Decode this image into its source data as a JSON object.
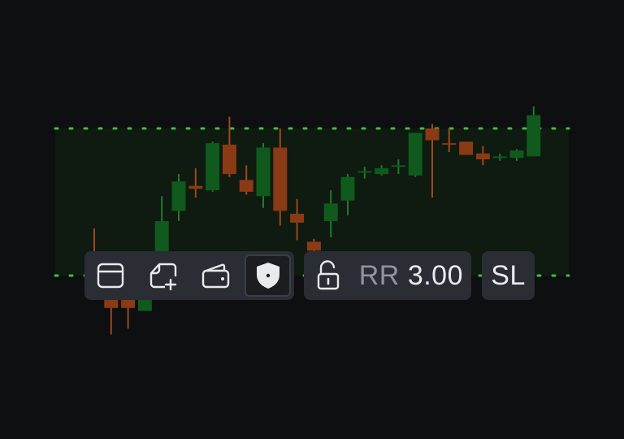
{
  "colors": {
    "background": "#0e0f11",
    "zone_fill": "#0f1a10",
    "zone_line": "#3fbf3f",
    "bull": "#0f5a1c",
    "bull_wick": "#1f7a2c",
    "bear": "#8a3a14",
    "bear_wick": "#9a4a20",
    "toolbar_bg": "#2a2d33",
    "icon": "#e8eaed",
    "muted_text": "#8f949c"
  },
  "toolbar": {
    "tools": [
      {
        "name": "panel-icon",
        "active": false
      },
      {
        "name": "note-add-icon",
        "active": false
      },
      {
        "name": "wallet-icon",
        "active": false
      },
      {
        "name": "shield-icon",
        "active": true
      }
    ],
    "lock": {
      "name": "lock-open-icon"
    },
    "rr_label": "RR",
    "rr_value": "3.00",
    "sl_label": "SL"
  },
  "chart_data": {
    "type": "candlestick",
    "zone": {
      "top": 1,
      "bottom": 0
    },
    "candles": [
      {
        "o": 0.14,
        "h": 0.32,
        "l": 0.03,
        "c": 0.1
      },
      {
        "o": -0.12,
        "h": -0.14,
        "l": -0.4,
        "c": -0.22
      },
      {
        "o": -0.16,
        "h": -0.14,
        "l": -0.36,
        "c": -0.22
      },
      {
        "o": -0.24,
        "h": 0.05,
        "l": -0.24,
        "c": -0.08
      },
      {
        "o": 0.14,
        "h": 0.54,
        "l": 0.14,
        "c": 0.37
      },
      {
        "o": 0.44,
        "h": 0.69,
        "l": 0.37,
        "c": 0.64
      },
      {
        "o": 0.61,
        "h": 0.73,
        "l": 0.53,
        "c": 0.59
      },
      {
        "o": 0.58,
        "h": 0.91,
        "l": 0.57,
        "c": 0.9
      },
      {
        "o": 0.89,
        "h": 1.08,
        "l": 0.67,
        "c": 0.69
      },
      {
        "o": 0.65,
        "h": 0.75,
        "l": 0.55,
        "c": 0.57
      },
      {
        "o": 0.54,
        "h": 0.9,
        "l": 0.46,
        "c": 0.87
      },
      {
        "o": 0.87,
        "h": 1.0,
        "l": 0.34,
        "c": 0.44
      },
      {
        "o": 0.42,
        "h": 0.52,
        "l": 0.24,
        "c": 0.36
      },
      {
        "o": 0.23,
        "h": 0.25,
        "l": 0.15,
        "c": 0.17
      },
      {
        "o": 0.37,
        "h": 0.58,
        "l": 0.26,
        "c": 0.49
      },
      {
        "o": 0.51,
        "h": 0.69,
        "l": 0.41,
        "c": 0.67
      },
      {
        "o": 0.7,
        "h": 0.74,
        "l": 0.66,
        "c": 0.71
      },
      {
        "o": 0.69,
        "h": 0.75,
        "l": 0.68,
        "c": 0.73
      },
      {
        "o": 0.74,
        "h": 0.79,
        "l": 0.69,
        "c": 0.75
      },
      {
        "o": 0.68,
        "h": 0.97,
        "l": 0.67,
        "c": 0.97
      },
      {
        "o": 1.0,
        "h": 1.03,
        "l": 0.53,
        "c": 0.92
      },
      {
        "o": 0.9,
        "h": 1.0,
        "l": 0.84,
        "c": 0.89
      },
      {
        "o": 0.91,
        "h": 0.91,
        "l": 0.84,
        "c": 0.82
      },
      {
        "o": 0.83,
        "h": 0.88,
        "l": 0.75,
        "c": 0.79
      },
      {
        "o": 0.81,
        "h": 0.83,
        "l": 0.78,
        "c": 0.81
      },
      {
        "o": 0.8,
        "h": 0.86,
        "l": 0.78,
        "c": 0.85
      },
      {
        "o": 0.81,
        "h": 1.15,
        "l": 0.81,
        "c": 1.09
      }
    ]
  }
}
